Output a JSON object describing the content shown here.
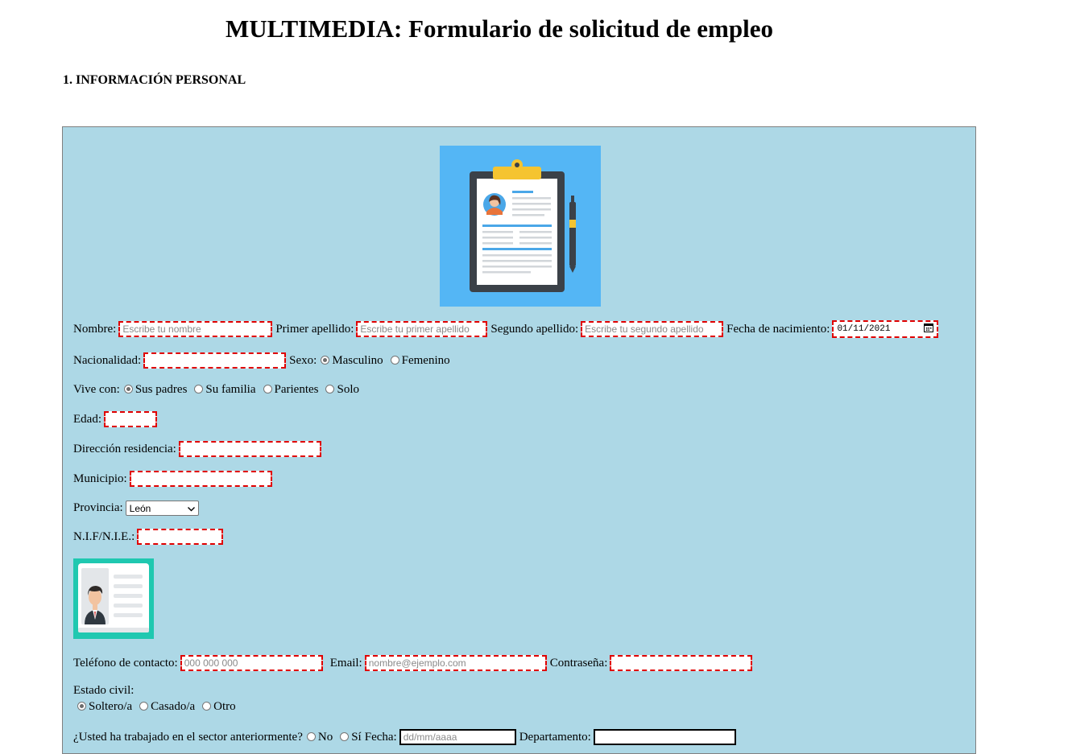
{
  "page": {
    "title": "MULTIMEDIA: Formulario de solicitud de empleo",
    "section_title": "1. INFORMACIÓN PERSONAL"
  },
  "form": {
    "nombre": {
      "label": "Nombre:",
      "placeholder": "Escribe tu nombre"
    },
    "primer_apellido": {
      "label": "Primer apellido:",
      "placeholder": "Escribe tu primer apellido"
    },
    "segundo_apellido": {
      "label": "Segundo apellido:",
      "placeholder": "Escribe tu segundo apellido"
    },
    "fecha_nacimiento": {
      "label": "Fecha de nacimiento:",
      "value": "01/11/2021"
    },
    "nacionalidad": {
      "label": "Nacionalidad:"
    },
    "sexo": {
      "label": "Sexo:",
      "options": [
        "Masculino",
        "Femenino"
      ],
      "selected": "Masculino"
    },
    "vive_con": {
      "label": "Vive con:",
      "options": [
        "Sus padres",
        "Su familia",
        "Parientes",
        "Solo"
      ],
      "selected": "Sus padres"
    },
    "edad": {
      "label": "Edad:"
    },
    "direccion": {
      "label": "Dirección residencia:"
    },
    "municipio": {
      "label": "Municipio:"
    },
    "provincia": {
      "label": "Provincia:",
      "value": "León"
    },
    "nif": {
      "label": "N.I.F/N.I.E.:"
    },
    "telefono": {
      "label": "Teléfono de contacto:",
      "placeholder": "000 000 000"
    },
    "email": {
      "label": "Email:",
      "placeholder": "nombre@ejemplo.com"
    },
    "contrasena": {
      "label": "Contraseña:"
    },
    "estado_civil": {
      "label": "Estado civil:",
      "options": [
        "Soltero/a",
        "Casado/a",
        "Otro"
      ],
      "selected": "Soltero/a"
    },
    "trabajo_previo": {
      "label": "¿Usted ha trabajado en el sector anteriormente?",
      "options": [
        "No",
        "Sí"
      ],
      "fecha_label": "Fecha:",
      "fecha_placeholder": "dd/mm/aaaa",
      "departamento_label": "Departamento:"
    }
  },
  "images": {
    "top": "clipboard-resume-icon",
    "id_card": "id-card-icon"
  },
  "colors": {
    "form_background": "#add8e6",
    "input_border": "#e00000",
    "clipboard_background": "#54b6f5",
    "id_card_background": "#1fc8b0"
  }
}
